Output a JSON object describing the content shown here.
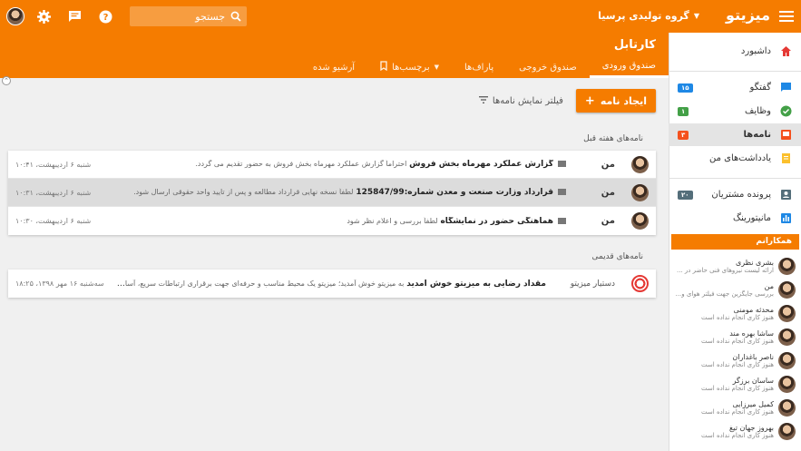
{
  "topbar": {
    "brand": "میزیتو",
    "org": "گروه تولیدی پرسیا",
    "search_placeholder": "جستجو",
    "icons": [
      "menu-icon",
      "caret-down-icon",
      "search-icon",
      "help-icon",
      "chat-icon",
      "gear-icon",
      "user-avatar"
    ],
    "color": "#f57c00"
  },
  "header": {
    "title": "کارتابل",
    "tabs": [
      {
        "label": "صندوق ورودی"
      },
      {
        "label": "صندوق خروجی"
      },
      {
        "label": "پاراف‌ها"
      },
      {
        "label": "برچسب‌ها"
      },
      {
        "label": "آرشیو شده"
      }
    ]
  },
  "actions": {
    "create_label": "ایجاد نامه",
    "filter_label": "فیلتر نمایش نامه‌ها"
  },
  "sections": {
    "last_week": "نامه‌های هفته قبل",
    "older": "نامه‌های قدیمی"
  },
  "letters_last_week": [
    {
      "sender": "من",
      "subject": "گزارش عملکرد مهرماه بخش فروش",
      "preview": "احتراماً گزارش عملکرد مهرماه بخش فروش به حضور تقدیم می گردد.",
      "date": "شنبه ۶ اردیبهشت، ۱۰:۴۱"
    },
    {
      "sender": "من",
      "subject": "قرارداد وزارت صنعت و معدن شماره:125847/99",
      "preview": "لطفاً نسخه نهایی قرارداد مطالعه و پس از تایید واحد حقوقی ارسال شود.",
      "date": "شنبه ۶ اردیبهشت، ۱۰:۳۱"
    },
    {
      "sender": "من",
      "subject": "هماهنگی حضور در نمایشگاه",
      "preview": "لطفاً بررسی و اعلام نظر شود",
      "date": "شنبه ۶ اردیبهشت، ۱۰:۳۰"
    }
  ],
  "letters_older": [
    {
      "sender": "دستیار میزیتو",
      "subject": "مقداد رضایی به میزیتو خوش آمدید",
      "preview": "به میزیتو خوش آمدید؛ میزیتو یک محیط مناسب و حرفه‌ای جهت برقراری ارتباطات سریع، آسان و امن در راس...",
      "date": "سه‌شنبه ۱۶ مهر ۱۳۹۸، ۱۸:۲۵"
    }
  ],
  "sidebar": {
    "items": [
      {
        "label": "داشبورد",
        "badge": "",
        "icon_color": "#e53935"
      },
      {
        "label": "گفتگو",
        "badge": "۱۵",
        "badge_color": "#1e88e5",
        "icon_color": "#1e88e5"
      },
      {
        "label": "وظایف",
        "badge": "۱",
        "badge_color": "#43a047",
        "icon_color": "#43a047"
      },
      {
        "label": "نامه‌ها",
        "badge": "۳",
        "badge_color": "#f4511e",
        "icon_color": "#f4511e"
      },
      {
        "label": "یادداشت‌های من",
        "badge": "",
        "icon_color": "#fbc02d"
      },
      {
        "label": "پرونده مشتریان",
        "badge": "۲۰",
        "badge_color": "#546e7a",
        "icon_color": "#546e7a"
      },
      {
        "label": "مانیتورینگ",
        "badge": "",
        "icon_color": "#1e88e5"
      }
    ],
    "coworkers_title": "همکارانم",
    "coworkers": [
      {
        "name": "بشری نظری",
        "status": "ارائه لیست نیروهای فنی حاضر در ..."
      },
      {
        "name": "من",
        "status": "بررسی جایگزین جهت فیلتر هوای و..."
      },
      {
        "name": "محدثه مومنی",
        "status": "هنوز کاری انجام نداده است"
      },
      {
        "name": "ساشا بهره مند",
        "status": "هنوز کاری انجام نداده است"
      },
      {
        "name": "ناصر باغداران",
        "status": "هنوز کاری انجام نداده است"
      },
      {
        "name": "ساسان برزگر",
        "status": "هنوز کاری انجام نداده است"
      },
      {
        "name": "کمیل میرزایی",
        "status": "هنوز کاری انجام نداده است"
      },
      {
        "name": "بهروز جهان تیغ",
        "status": "هنوز کاری انجام نداده است"
      }
    ]
  }
}
